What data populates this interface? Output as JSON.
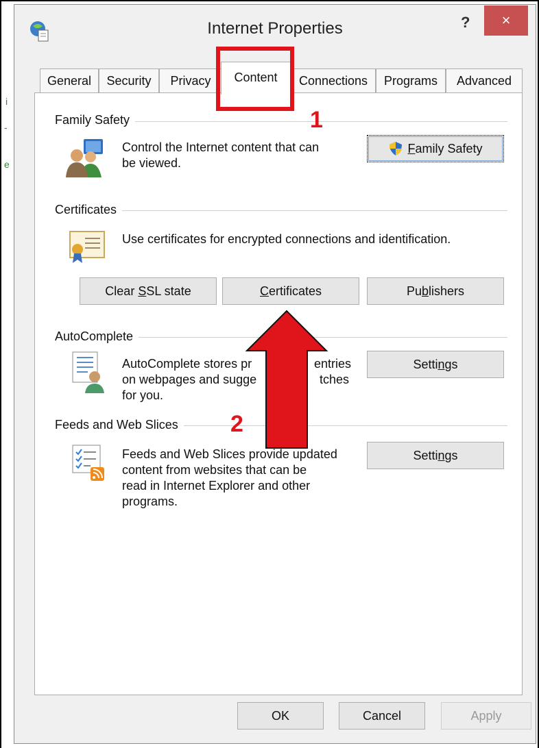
{
  "window": {
    "title": "Internet Properties",
    "help_label": "?",
    "close_label": "×"
  },
  "tabs": [
    {
      "label": "General"
    },
    {
      "label": "Security"
    },
    {
      "label": "Privacy"
    },
    {
      "label": "Content",
      "active": true
    },
    {
      "label": "Connections"
    },
    {
      "label": "Programs"
    },
    {
      "label": "Advanced"
    }
  ],
  "family_safety": {
    "group_label": "Family Safety",
    "line1": "Control the Internet content that can",
    "line2": "be viewed.",
    "button_label": "Family Safety",
    "button_accel": "F",
    "button_rest": "amily Safety"
  },
  "certificates": {
    "group_label": "Certificates",
    "description": "Use certificates for encrypted connections and identification.",
    "clear_ssl": {
      "pre": "Clear ",
      "accel": "S",
      "post": "SL state"
    },
    "certificates_btn": {
      "pre": "",
      "accel": "C",
      "post": "ertificates"
    },
    "publishers_btn": {
      "pre": "Pu",
      "accel": "b",
      "post": "lishers"
    }
  },
  "autocomplete": {
    "group_label": "AutoComplete",
    "line1": "AutoComplete stores pr",
    "line1b": "entries",
    "line2": "on webpages and sugge",
    "line2b": "tches",
    "line3": "for you.",
    "settings": {
      "pre": "Setti",
      "accel": "n",
      "post": "gs"
    }
  },
  "feeds": {
    "group_label": "Feeds and Web Slices",
    "line1": "Feeds and Web Slices provide updated",
    "line2": "content from websites that can be",
    "line3": "read in Internet Explorer and other",
    "line4": "programs.",
    "settings": {
      "pre": "Setti",
      "accel": "n",
      "post": "gs"
    }
  },
  "footer": {
    "ok_label": "OK",
    "cancel_label": "Cancel",
    "apply_label": "Apply"
  },
  "annotations": {
    "step1": "1",
    "step2": "2",
    "color": "#e0141b"
  },
  "side_glyphs": [
    "i",
    "-",
    "e"
  ]
}
